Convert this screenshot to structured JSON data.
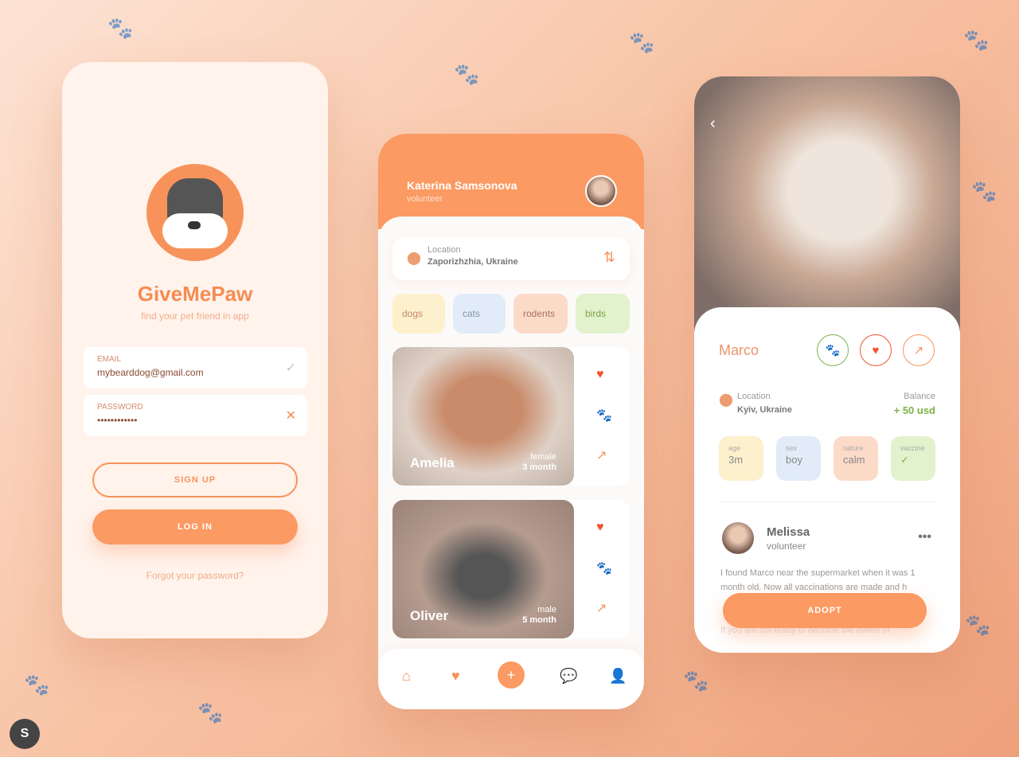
{
  "login": {
    "app_name": "GiveMePaw",
    "tagline": "find your pet friend in app",
    "email_label": "EMAIL",
    "email_value": "mybearddog@gmail.com",
    "password_label": "PASSWORD",
    "password_value": "••••••••••••",
    "signup": "SIGN UP",
    "login": "LOG IN",
    "forgot": "Forgot your password?"
  },
  "list": {
    "user_name": "Katerina Samsonova",
    "user_role": "volunteer",
    "location_label": "Location",
    "location_value": "Zaporizhzhia, Ukraine",
    "categories": [
      "dogs",
      "cats",
      "rodents",
      "birds"
    ],
    "pets": [
      {
        "name": "Amelia",
        "sex": "female",
        "age": "3 month"
      },
      {
        "name": "Oliver",
        "sex": "male",
        "age": "5 month"
      }
    ]
  },
  "detail": {
    "name": "Marco",
    "location_label": "Location",
    "location_value": "Kyiv, Ukraine",
    "balance_label": "Balance",
    "balance_value": "+ 50 usd",
    "stats": [
      {
        "label": "age",
        "value": "3m"
      },
      {
        "label": "sex",
        "value": "boy"
      },
      {
        "label": "nature",
        "value": "calm"
      },
      {
        "label": "vaccine",
        "value": "✓"
      }
    ],
    "author_name": "Melissa",
    "author_role": "volunteer",
    "story": "I found Marco near the supermarket when it was 1 month old.  Now all vaccinations are made and h",
    "story_more": "If you are not ready to become the owner of",
    "adopt": "ADOPT"
  },
  "colors": {
    "accent": "#fb9a62",
    "green": "#7fb24a",
    "heart": "#f2542d"
  }
}
